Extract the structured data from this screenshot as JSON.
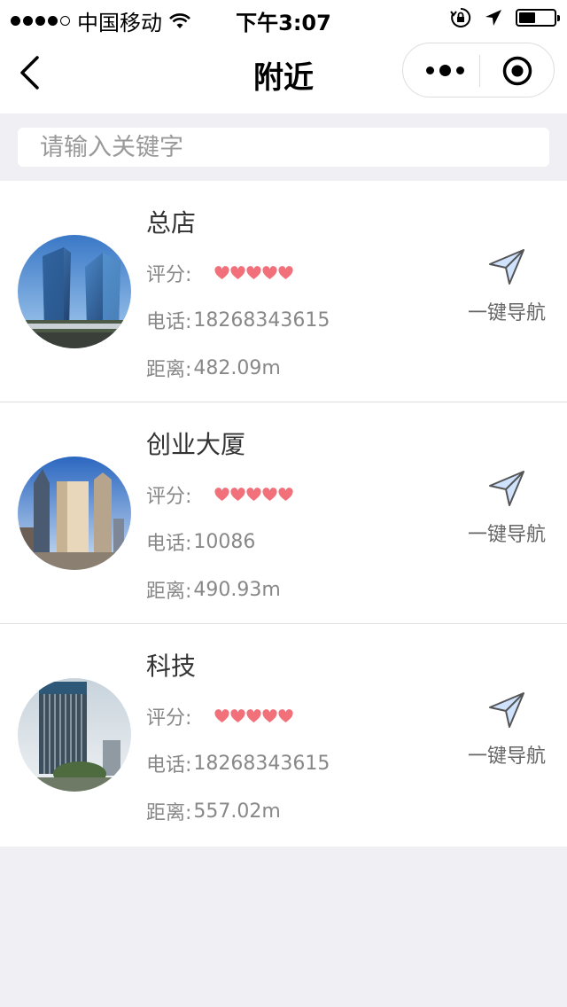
{
  "status_bar": {
    "carrier": "中国移动",
    "time": "下午3:07"
  },
  "nav": {
    "title": "附近"
  },
  "search": {
    "placeholder": "请输入关键字"
  },
  "labels": {
    "rating": "评分:",
    "phone": "电话:",
    "distance": "距离:",
    "navigate": "一键导航"
  },
  "colors": {
    "heart": "#f2707a",
    "nav_icon_fill": "#cfe3ff"
  },
  "stores": [
    {
      "name": "总店",
      "rating": 5,
      "phone": "18268343615",
      "distance": "482.09m"
    },
    {
      "name": "创业大厦",
      "rating": 5,
      "phone": "10086",
      "distance": "490.93m"
    },
    {
      "name": "科技",
      "rating": 5,
      "phone": "18268343615",
      "distance": "557.02m"
    }
  ]
}
